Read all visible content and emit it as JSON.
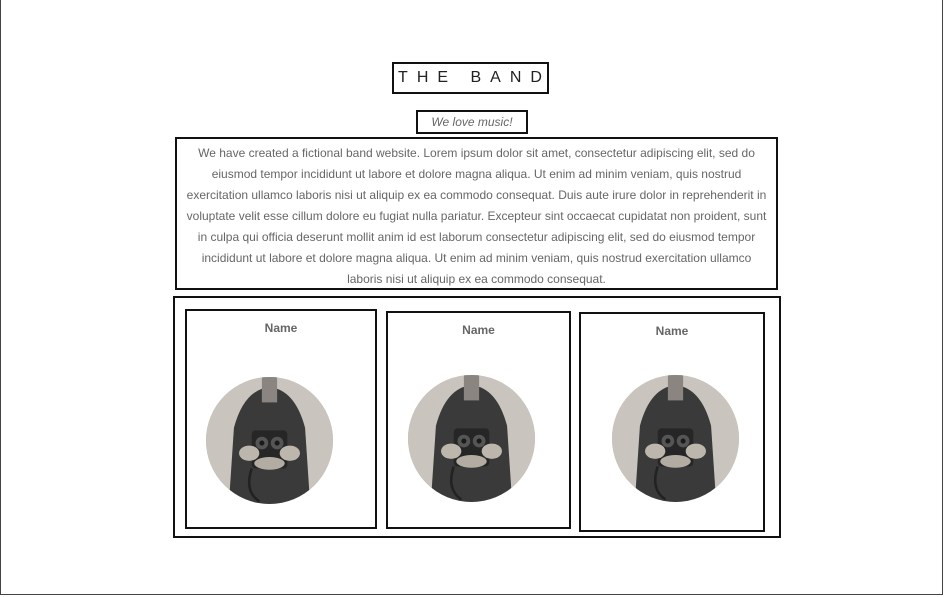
{
  "header": {
    "title": "THE BAND",
    "tagline": "We love music!"
  },
  "description": "We have created a fictional band website. Lorem ipsum dolor sit amet, consectetur adipiscing elit, sed do eiusmod tempor incididunt ut labore et dolore magna aliqua. Ut enim ad minim veniam, quis nostrud exercitation ullamco laboris nisi ut aliquip ex ea commodo consequat. Duis aute irure dolor in reprehenderit in voluptate velit esse cillum dolore eu fugiat nulla pariatur. Excepteur sint occaecat cupidatat non proident, sunt in culpa qui officia deserunt mollit anim id est laborum consectetur adipiscing elit, sed do eiusmod tempor incididunt ut labore et dolore magna aliqua. Ut enim ad minim veniam, quis nostrud exercitation ullamco laboris nisi ut aliquip ex ea commodo consequat.",
  "members": [
    {
      "name": "Name",
      "photo": "camera-holder-photo"
    },
    {
      "name": "Name",
      "photo": "camera-holder-photo"
    },
    {
      "name": "Name",
      "photo": "camera-holder-photo"
    }
  ],
  "colors": {
    "border": "#111111",
    "text": "#666666",
    "title": "#222222"
  }
}
